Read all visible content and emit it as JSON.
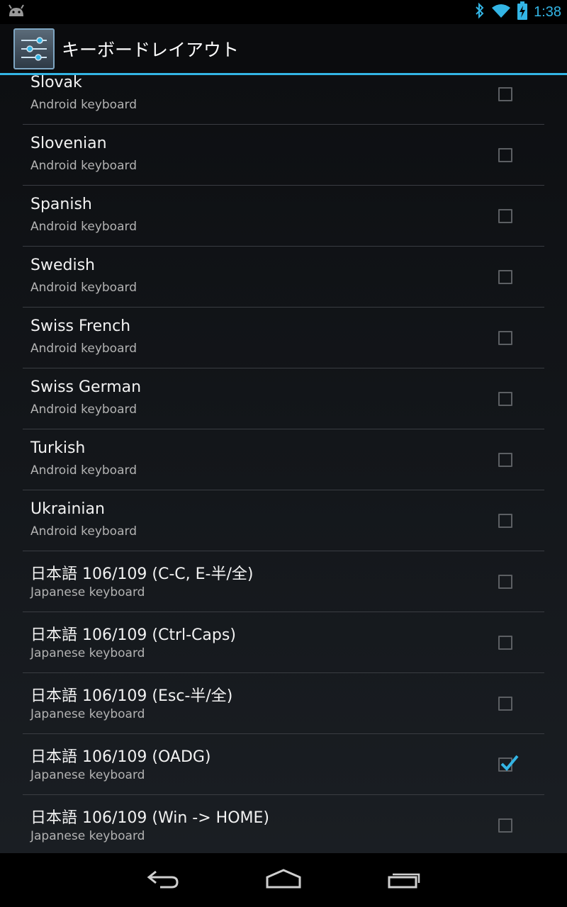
{
  "status_bar": {
    "time": "1:38",
    "icons": [
      "android-icon",
      "bluetooth-icon",
      "wifi-icon",
      "battery-charging-icon"
    ]
  },
  "action_bar": {
    "title": "キーボードレイアウト",
    "icon": "settings-sliders-icon"
  },
  "keyboard_layouts": [
    {
      "name": "Slovak",
      "source": "Android keyboard",
      "checked": false
    },
    {
      "name": "Slovenian",
      "source": "Android keyboard",
      "checked": false
    },
    {
      "name": "Spanish",
      "source": "Android keyboard",
      "checked": false
    },
    {
      "name": "Swedish",
      "source": "Android keyboard",
      "checked": false
    },
    {
      "name": "Swiss French",
      "source": "Android keyboard",
      "checked": false
    },
    {
      "name": "Swiss German",
      "source": "Android keyboard",
      "checked": false
    },
    {
      "name": "Turkish",
      "source": "Android keyboard",
      "checked": false
    },
    {
      "name": "Ukrainian",
      "source": "Android keyboard",
      "checked": false
    },
    {
      "name": "日本語 106/109 (C-C, E-半/全)",
      "source": "Japanese keyboard",
      "checked": false
    },
    {
      "name": "日本語 106/109 (Ctrl-Caps)",
      "source": "Japanese keyboard",
      "checked": false
    },
    {
      "name": "日本語 106/109 (Esc-半/全)",
      "source": "Japanese keyboard",
      "checked": false
    },
    {
      "name": "日本語 106/109 (OADG)",
      "source": "Japanese keyboard",
      "checked": true
    },
    {
      "name": "日本語 106/109 (Win -> HOME)",
      "source": "Japanese keyboard",
      "checked": false
    }
  ],
  "nav_bar": {
    "buttons": [
      "back-icon",
      "home-icon",
      "recent-apps-icon"
    ]
  },
  "colors": {
    "accent": "#33b5e5",
    "background": "#0d0f12",
    "divider": "#3a3d42"
  }
}
